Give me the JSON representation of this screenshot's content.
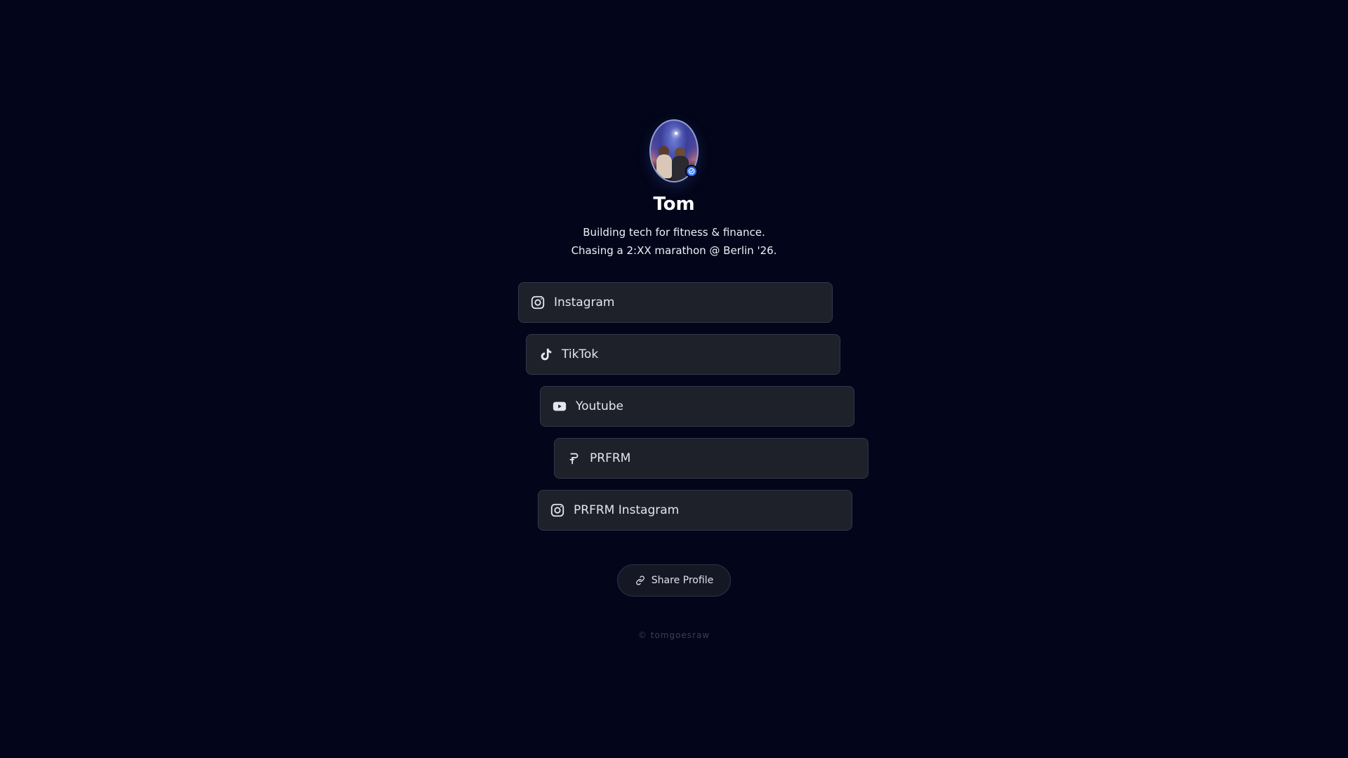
{
  "profile": {
    "name": "Tom",
    "bio_line1": "Building tech for fitness & finance.",
    "bio_line2": "Chasing a 2:XX marathon @ Berlin '26.",
    "verified": true
  },
  "links": [
    {
      "label": "Instagram",
      "icon": "instagram-icon"
    },
    {
      "label": "TikTok",
      "icon": "tiktok-icon"
    },
    {
      "label": "Youtube",
      "icon": "youtube-icon"
    },
    {
      "label": "PRFRM",
      "icon": "prfrm-icon"
    },
    {
      "label": "PRFRM Instagram",
      "icon": "instagram-icon"
    }
  ],
  "share": {
    "label": "Share Profile",
    "icon": "link-icon"
  },
  "footer": {
    "text": "© tomgoesraw"
  },
  "colors": {
    "background": "#03061a",
    "card": "#1e202a",
    "verified": "#2f6ff0"
  }
}
